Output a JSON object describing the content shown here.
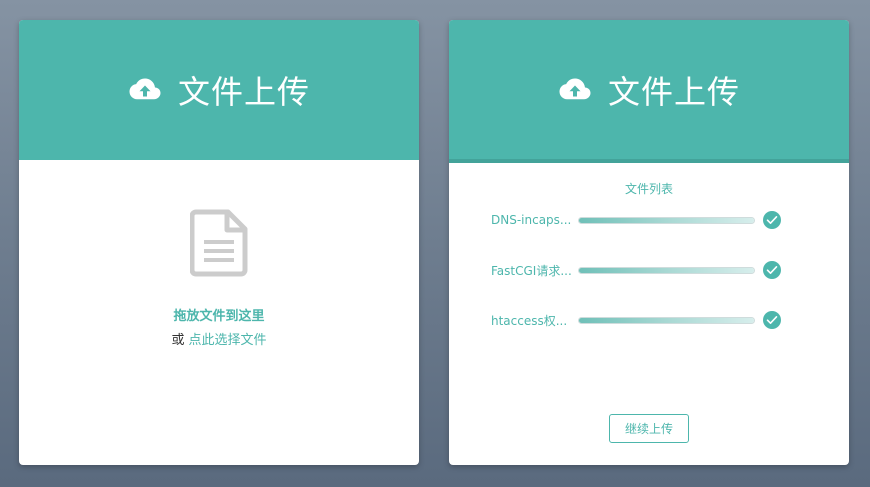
{
  "left_card": {
    "header_title": "文件上传",
    "icon": "cloud-upload-icon",
    "drop_icon": "document-icon",
    "drop_title": "拖放文件到这里",
    "or_text": "或",
    "select_link": "点此选择文件"
  },
  "right_card": {
    "header_title": "文件上传",
    "icon": "cloud-upload-icon",
    "list_title": "文件列表",
    "files": [
      {
        "name": "DNS-incaps...",
        "progress": 1.0,
        "status": "done"
      },
      {
        "name": "FastCGI请求...",
        "progress": 1.0,
        "status": "done"
      },
      {
        "name": "htaccess权...",
        "progress": 1.0,
        "status": "done"
      }
    ],
    "continue_label": "继续上传"
  },
  "colors": {
    "accent": "#4db6ac",
    "background": "#6e7d8f",
    "doc_icon": "#cccccc"
  }
}
